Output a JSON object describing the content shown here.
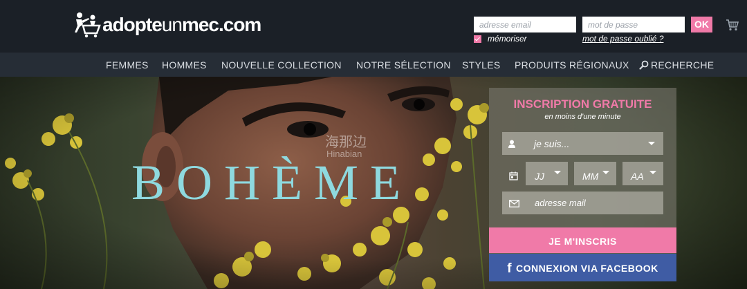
{
  "brand": {
    "logo_bold": "adopte",
    "logo_thin": "un",
    "logo_tail": "mec.com"
  },
  "login": {
    "email_placeholder": "adresse email",
    "password_placeholder": "mot de passe",
    "ok_label": "OK",
    "remember_label": "mémoriser",
    "remember_checked": true,
    "forgot_label": "mot de passe oublié ?"
  },
  "nav": {
    "items": [
      "FEMMES",
      "HOMMES",
      "NOUVELLE COLLECTION",
      "NOTRE SÉLECTION",
      "STYLES",
      "PRODUITS RÉGIONAUX"
    ],
    "search_label": "RECHERCHE"
  },
  "hero": {
    "word": "BOHÈME",
    "watermark": "海那边",
    "watermark_sub": "Hinabian"
  },
  "signup": {
    "title": "INSCRIPTION GRATUITE",
    "subtitle": "en moins d'une minute",
    "gender_placeholder": "je suis...",
    "day_placeholder": "JJ",
    "month_placeholder": "MM",
    "year_placeholder": "AA",
    "email_placeholder": "adresse mail",
    "submit_label": "JE M'INSCRIS",
    "facebook_label": "CONNEXION VIA FACEBOOK"
  },
  "colors": {
    "accent_pink": "#f07aa8",
    "facebook_blue": "#3f5ca4",
    "hero_word": "#8ed9df",
    "topbar": "#1b2027",
    "navbar": "#262d36"
  },
  "icons": {
    "cart": "cart-icon",
    "search": "search-icon",
    "user": "user-icon",
    "calendar": "calendar-icon",
    "mail": "envelope-icon",
    "facebook": "facebook-icon"
  }
}
